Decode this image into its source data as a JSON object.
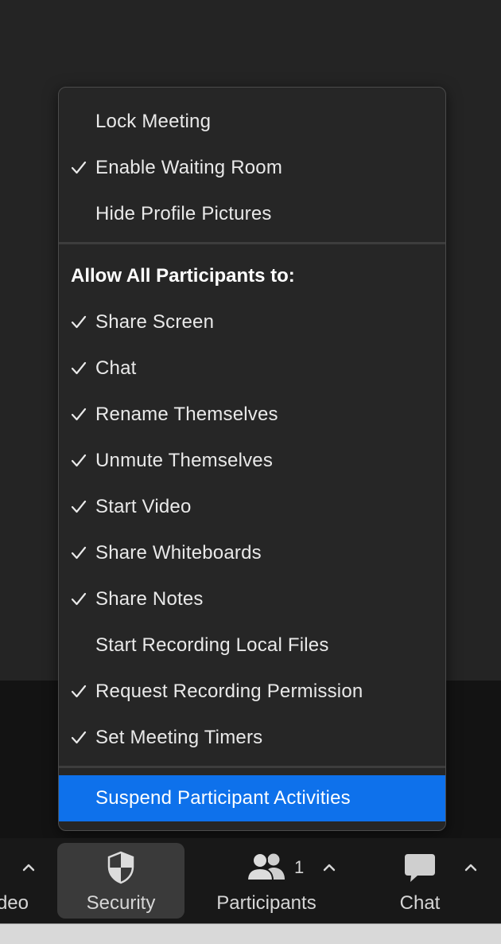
{
  "menu": {
    "items_top": [
      {
        "label": "Lock Meeting",
        "checked": false
      },
      {
        "label": "Enable Waiting Room",
        "checked": true
      },
      {
        "label": "Hide Profile Pictures",
        "checked": false
      }
    ],
    "section_heading": "Allow All Participants to:",
    "participant_permissions": [
      {
        "label": "Share Screen",
        "checked": true
      },
      {
        "label": "Chat",
        "checked": true
      },
      {
        "label": "Rename Themselves",
        "checked": true
      },
      {
        "label": "Unmute Themselves",
        "checked": true
      },
      {
        "label": "Start Video",
        "checked": true
      },
      {
        "label": "Share Whiteboards",
        "checked": true
      },
      {
        "label": "Share Notes",
        "checked": true
      },
      {
        "label": "Start Recording Local Files",
        "checked": false
      },
      {
        "label": "Request Recording Permission",
        "checked": true
      },
      {
        "label": "Set Meeting Timers",
        "checked": true
      }
    ],
    "suspend_label": "Suspend Participant Activities",
    "highlight_color": "#0e71eb"
  },
  "toolbar": {
    "video_label": "deo",
    "security_label": "Security",
    "participants_label": "Participants",
    "participants_count": "1",
    "chat_label": "Chat"
  }
}
